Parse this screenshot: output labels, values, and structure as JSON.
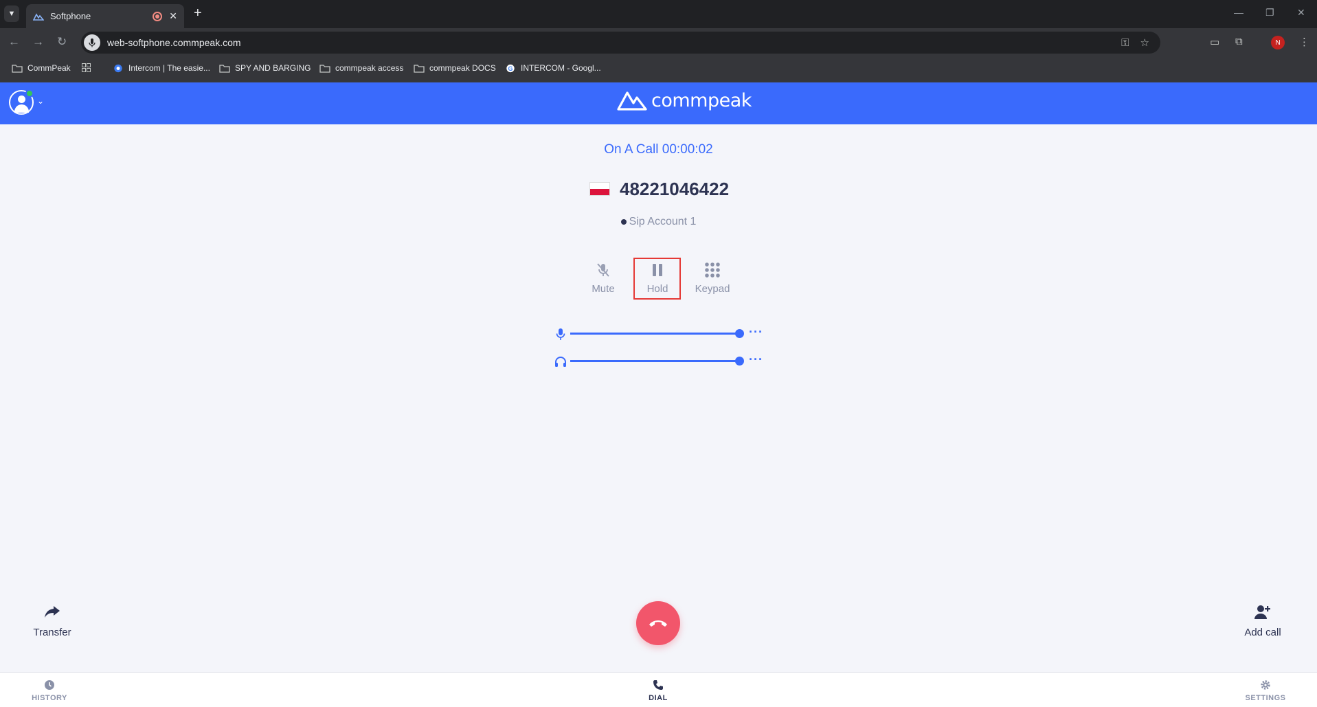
{
  "browser": {
    "tab_title": "Softphone",
    "url": "web-softphone.commpeak.com",
    "bookmarks": [
      {
        "label": "CommPeak",
        "icon": "folder-icon"
      },
      {
        "label": "Intercom | The easie...",
        "icon": "intercom-icon"
      },
      {
        "label": "SPY AND BARGING",
        "icon": "folder-icon"
      },
      {
        "label": "commpeak access",
        "icon": "folder-icon"
      },
      {
        "label": "commpeak DOCS",
        "icon": "folder-icon"
      },
      {
        "label": "INTERCOM - Googl...",
        "icon": "google-icon"
      }
    ],
    "profile_initial": "N"
  },
  "app": {
    "brand": "commpeak",
    "accent_color": "#3a6afc",
    "hangup_color": "#f2566b"
  },
  "call": {
    "status": "On A Call 00:00:02",
    "number": "48221046422",
    "country_flag": "poland-flag",
    "account": "Sip Account 1",
    "controls": {
      "mute": "Mute",
      "hold": "Hold",
      "keypad": "Keypad"
    },
    "mic_volume": 1.0,
    "speaker_volume": 1.0
  },
  "actions": {
    "transfer": "Transfer",
    "add_call": "Add call"
  },
  "bottom_nav": {
    "history": "HISTORY",
    "dial": "DIAL",
    "settings": "SETTINGS"
  }
}
